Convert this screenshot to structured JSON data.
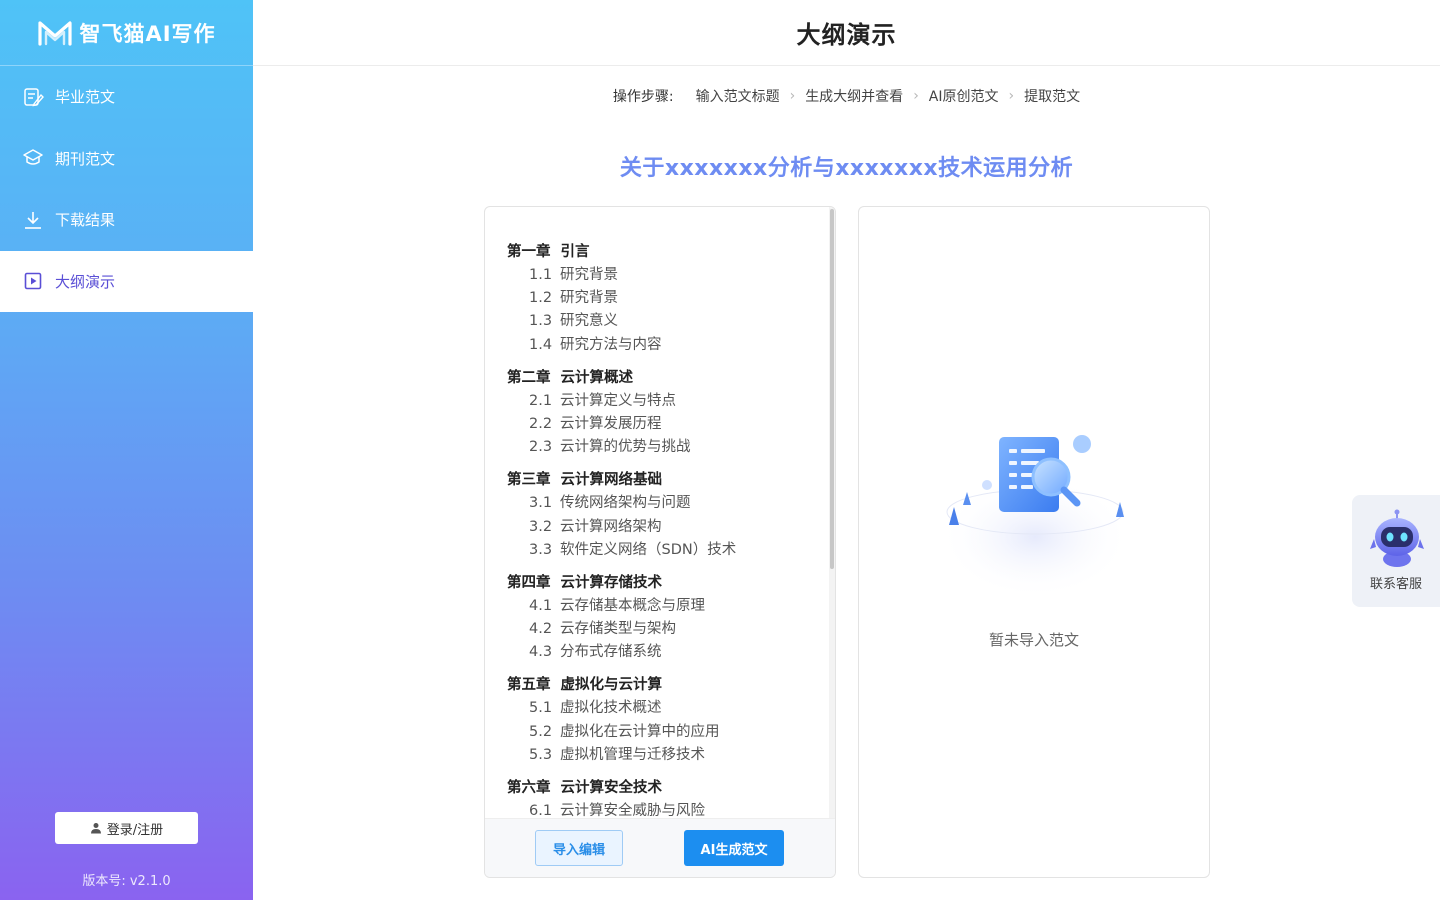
{
  "app": {
    "name": "智飞猫AI写作",
    "version": "版本号: v2.1.0"
  },
  "sidebar": {
    "items": [
      {
        "label": "毕业范文",
        "icon": "edit-document-icon",
        "active": false
      },
      {
        "label": "期刊范文",
        "icon": "graduation-cap-icon",
        "active": false
      },
      {
        "label": "下载结果",
        "icon": "download-icon",
        "active": false
      },
      {
        "label": "大纲演示",
        "icon": "play-square-icon",
        "active": true
      }
    ],
    "login_label": "登录/注册"
  },
  "header": {
    "title": "大纲演示"
  },
  "steps": {
    "label": "操作步骤:",
    "items": [
      "输入范文标题",
      "生成大纲并查看",
      "AI原创范文",
      "提取范文"
    ]
  },
  "essay_title": "关于xxxxxxx分析与xxxxxxx技术运用分析",
  "outline": {
    "chapters": [
      {
        "num": "第一章",
        "title": "引言",
        "sections": [
          {
            "num": "1.1",
            "title": "研究背景"
          },
          {
            "num": "1.2",
            "title": "研究背景"
          },
          {
            "num": "1.3",
            "title": "研究意义"
          },
          {
            "num": "1.4",
            "title": "研究方法与内容"
          }
        ]
      },
      {
        "num": "第二章",
        "title": "云计算概述",
        "sections": [
          {
            "num": "2.1",
            "title": "云计算定义与特点"
          },
          {
            "num": "2.2",
            "title": "云计算发展历程"
          },
          {
            "num": "2.3",
            "title": "云计算的优势与挑战"
          }
        ]
      },
      {
        "num": "第三章",
        "title": "云计算网络基础",
        "sections": [
          {
            "num": "3.1",
            "title": "传统网络架构与问题"
          },
          {
            "num": "3.2",
            "title": "云计算网络架构"
          },
          {
            "num": "3.3",
            "title": "软件定义网络（SDN）技术"
          }
        ]
      },
      {
        "num": "第四章",
        "title": "云计算存储技术",
        "sections": [
          {
            "num": "4.1",
            "title": "云存储基本概念与原理"
          },
          {
            "num": "4.2",
            "title": "云存储类型与架构"
          },
          {
            "num": "4.3",
            "title": "分布式存储系统"
          }
        ]
      },
      {
        "num": "第五章",
        "title": "虚拟化与云计算",
        "sections": [
          {
            "num": "5.1",
            "title": "虚拟化技术概述"
          },
          {
            "num": "5.2",
            "title": "虚拟化在云计算中的应用"
          },
          {
            "num": "5.3",
            "title": "虚拟机管理与迁移技术"
          }
        ]
      },
      {
        "num": "第六章",
        "title": "云计算安全技术",
        "sections": [
          {
            "num": "6.1",
            "title": "云计算安全威胁与风险"
          }
        ]
      }
    ],
    "import_button": "导入编辑",
    "generate_button": "AI生成范文"
  },
  "result": {
    "empty_text": "暂未导入范文"
  },
  "customer_service": {
    "label": "联系客服"
  },
  "colors": {
    "sidebar_top": "#4fc3f7",
    "sidebar_bottom": "#8a63f0",
    "title_accent": "#6e8cf2",
    "primary_button": "#1c8ef0",
    "active_nav_text": "#5a4fd6"
  }
}
